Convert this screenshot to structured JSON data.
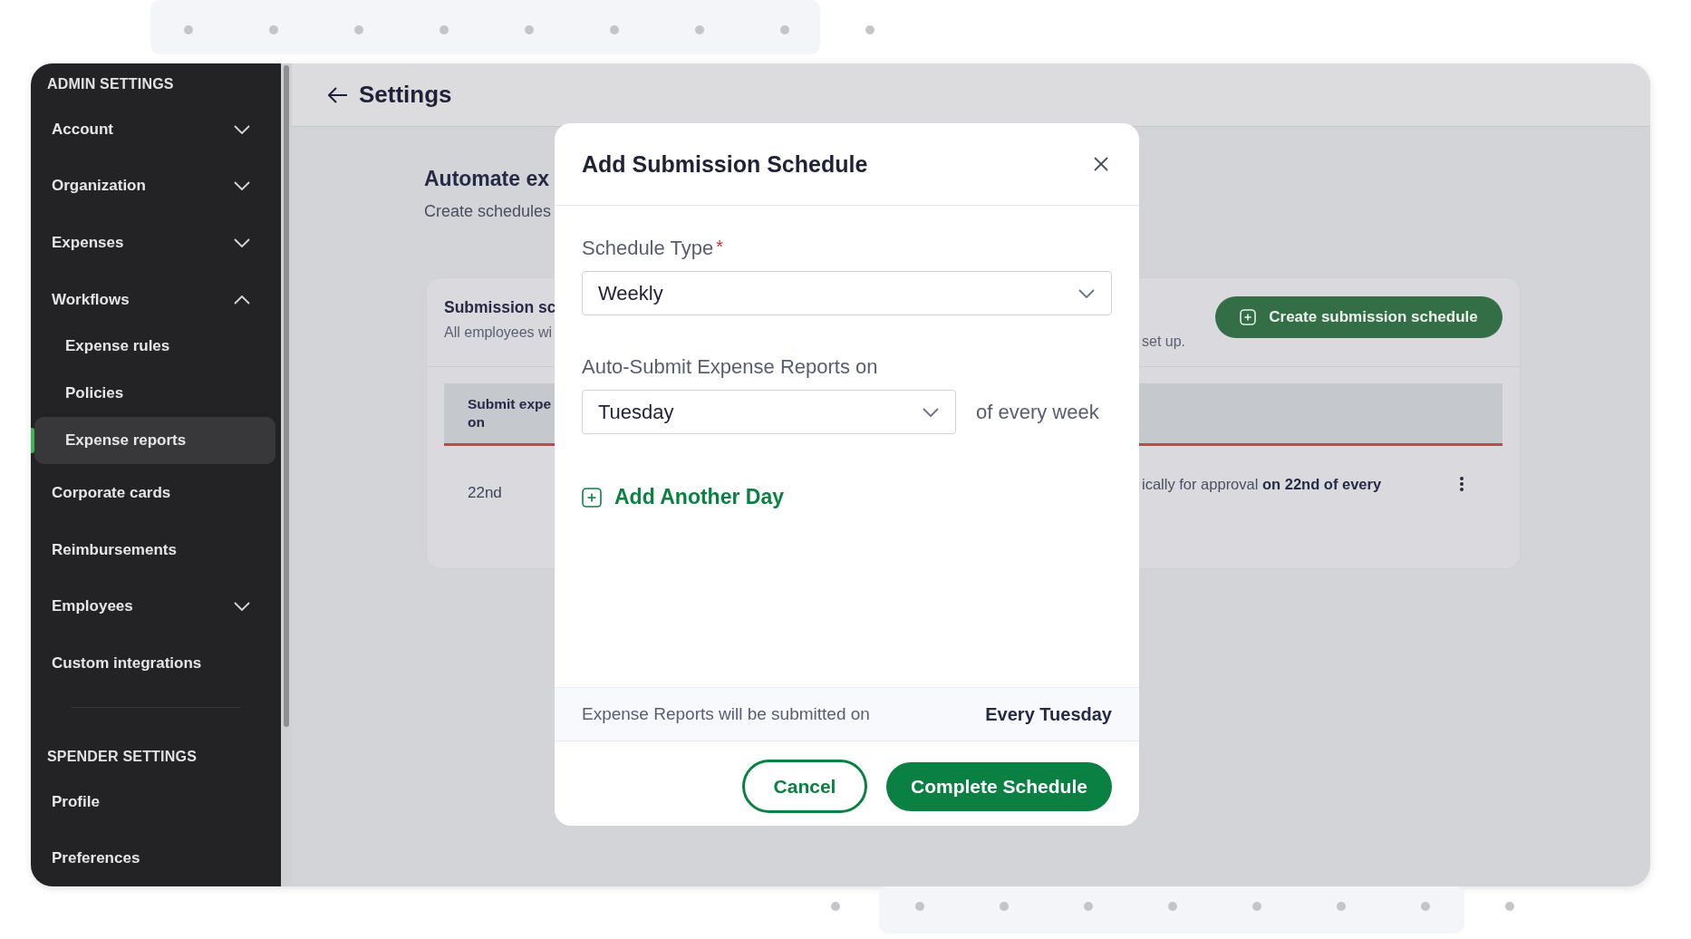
{
  "sidebar": {
    "sections": [
      {
        "title": "ADMIN SETTINGS",
        "items": [
          {
            "label": "Account",
            "kind": "group",
            "expanded": false,
            "selected": false
          },
          {
            "label": "Organization",
            "kind": "group",
            "expanded": false,
            "selected": false
          },
          {
            "label": "Expenses",
            "kind": "group",
            "expanded": false,
            "selected": false
          },
          {
            "label": "Workflows",
            "kind": "group",
            "expanded": true,
            "selected": false,
            "children": [
              {
                "label": "Expense rules",
                "selected": false
              },
              {
                "label": "Policies",
                "selected": false
              },
              {
                "label": "Expense reports",
                "selected": true
              }
            ]
          },
          {
            "label": "Corporate cards",
            "kind": "link",
            "selected": false
          },
          {
            "label": "Reimbursements",
            "kind": "link",
            "selected": false
          },
          {
            "label": "Employees",
            "kind": "group",
            "expanded": false,
            "selected": false
          },
          {
            "label": "Custom integrations",
            "kind": "link",
            "selected": false
          }
        ]
      },
      {
        "title": "SPENDER SETTINGS",
        "items": [
          {
            "label": "Profile",
            "kind": "link",
            "selected": false
          },
          {
            "label": "Preferences",
            "kind": "link",
            "selected": false
          }
        ]
      }
    ]
  },
  "header": {
    "title": "Settings"
  },
  "page": {
    "heading": "Automate ex",
    "subheading": "Create schedules"
  },
  "card": {
    "title": "Submission sc",
    "description": "All employees wi",
    "description_end": "set up.",
    "create_button": "Create submission schedule",
    "table": {
      "column_header": "Submit expe\non",
      "rows": [
        {
          "day": "22nd",
          "description": "ically for approval **on 22nd of every**"
        }
      ]
    }
  },
  "modal": {
    "title": "Add Submission Schedule",
    "schedule_type": {
      "label": "Schedule Type",
      "required_mark": "*",
      "value": "Weekly"
    },
    "auto_submit": {
      "label": "Auto-Submit Expense Reports on",
      "value": "Tuesday",
      "suffix": "of every week"
    },
    "add_day": "Add Another Day",
    "summary": {
      "label": "Expense Reports will be submitted on",
      "value": "Every Tuesday"
    },
    "buttons": {
      "cancel": "Cancel",
      "confirm": "Complete Schedule"
    }
  }
}
